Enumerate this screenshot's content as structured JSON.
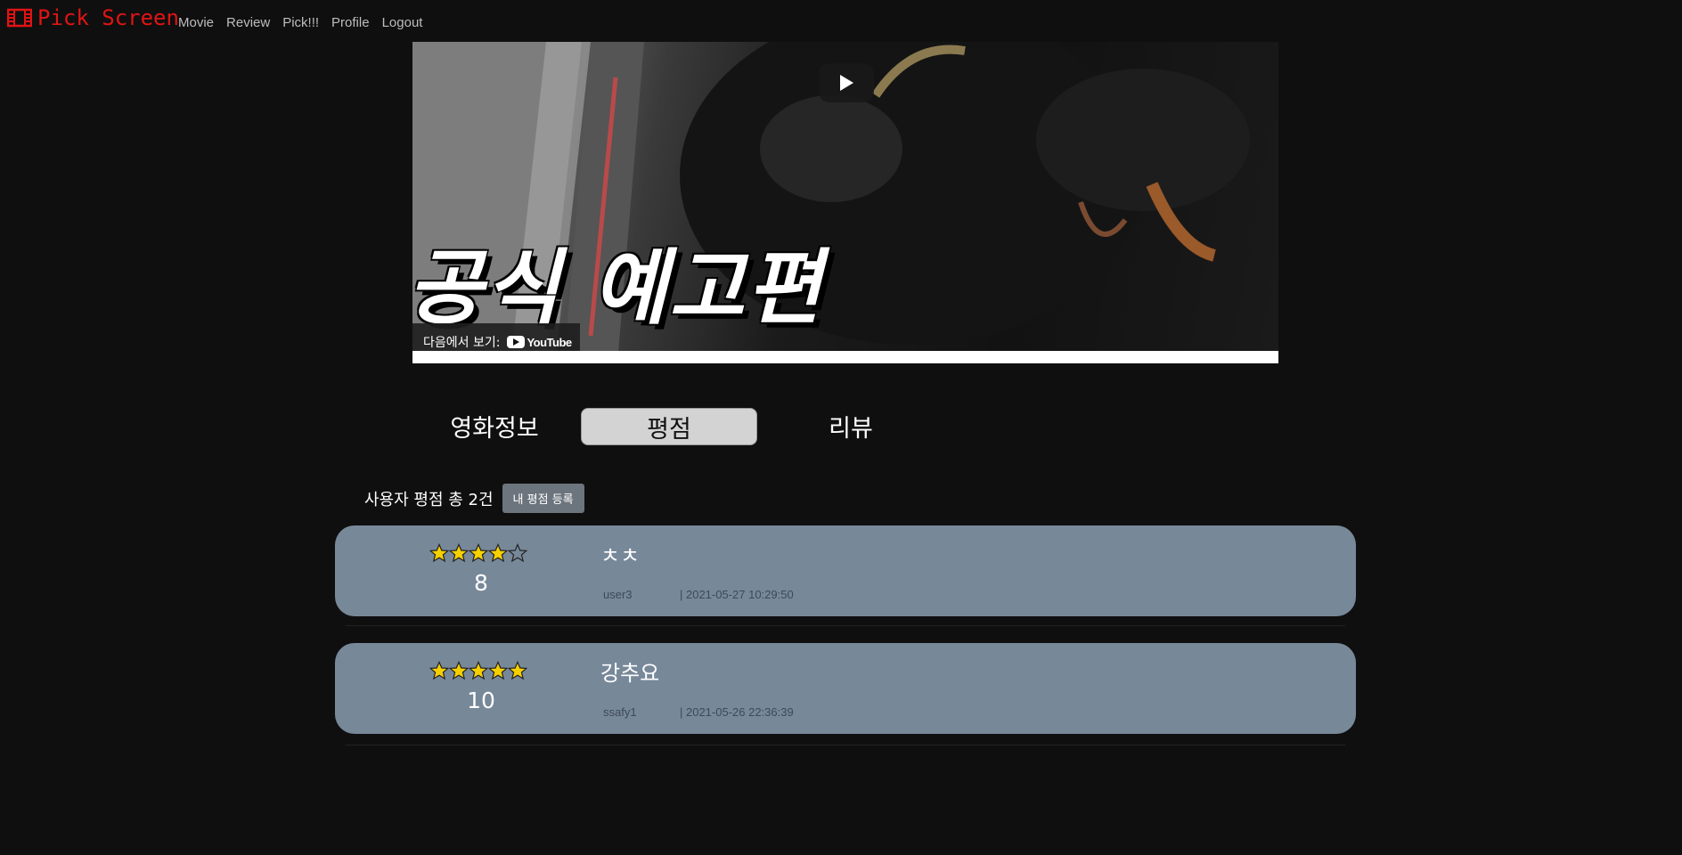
{
  "nav": {
    "brand": "Pick Screen",
    "brand_color": "#e01414",
    "links": [
      "Movie",
      "Review",
      "Pick!!!",
      "Profile",
      "Logout"
    ]
  },
  "video": {
    "overlay_text": "공식 예고편",
    "watch_on_label": "다음에서 보기:",
    "platform": "YouTube",
    "play_icon": "play-icon"
  },
  "tabs": [
    {
      "label": "영화정보",
      "active": false
    },
    {
      "label": "평점",
      "active": true
    },
    {
      "label": "리뷰",
      "active": false
    }
  ],
  "ratings": {
    "summary": "사용자 평점 총 2건",
    "add_button": "내 평점 등록",
    "card_color": "#778899",
    "items": [
      {
        "stars": 4,
        "max_stars": 5,
        "score": "8",
        "comment": "ㅊㅊ",
        "user": "user3",
        "date": "| 2021-05-27 10:29:50"
      },
      {
        "stars": 5,
        "max_stars": 5,
        "score": "10",
        "comment": "강추요",
        "user": "ssafy1",
        "date": "| 2021-05-26 22:36:39"
      }
    ]
  }
}
